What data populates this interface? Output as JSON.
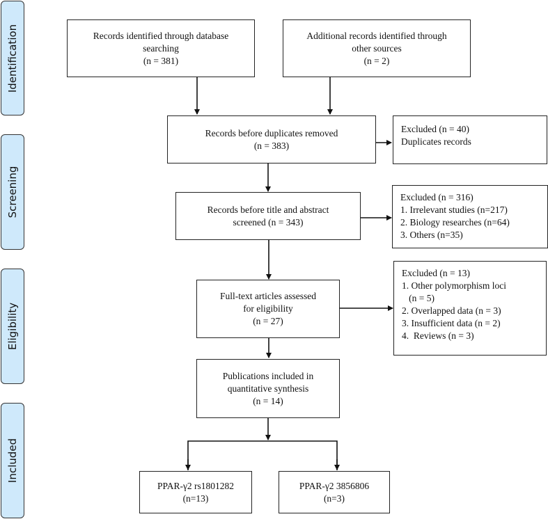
{
  "phases": [
    {
      "label": "Identification"
    },
    {
      "label": "Screening"
    },
    {
      "label": "Eligibility"
    },
    {
      "label": "Included"
    }
  ],
  "boxes": {
    "database": {
      "lines": [
        "Records identified through database",
        "searching",
        "(n = 381)"
      ]
    },
    "other_sources": {
      "lines": [
        "Additional records identified through",
        "other sources",
        "(n = 2)"
      ]
    },
    "before_duplicates": {
      "lines": [
        "Records before duplicates removed",
        "(n = 383)"
      ]
    },
    "excluded_duplicates": {
      "lines": [
        "Excluded (n = 40)",
        "Duplicates records"
      ]
    },
    "before_title": {
      "lines": [
        "Records before title and abstract",
        "screened (n = 343)"
      ]
    },
    "excluded_title": {
      "lines": [
        "Excluded (n = 316)",
        "1. Irrelevant studies (n=217)",
        "2. Biology researches (n=64)",
        "3. Others (n=35)"
      ]
    },
    "full_text": {
      "lines": [
        "Full-text articles assessed",
        "for eligibility",
        "(n = 27)"
      ]
    },
    "excluded_full_text": {
      "lines": [
        "Excluded (n = 13)",
        "1. Other polymorphism loci",
        "   (n = 5)",
        "2. Overlapped data (n = 3)",
        "3. Insufficient data (n = 2)",
        "4.  Reviews (n = 3)"
      ]
    },
    "publications": {
      "lines": [
        "Publications included in",
        "quantitative synthesis",
        "(n = 14)"
      ]
    },
    "rs1801282": {
      "lines": [
        "PPAR-γ2 rs1801282",
        "(n=13)"
      ]
    },
    "rs3856806": {
      "lines": [
        "PPAR-γ2 3856806",
        "(n=3)"
      ]
    }
  }
}
